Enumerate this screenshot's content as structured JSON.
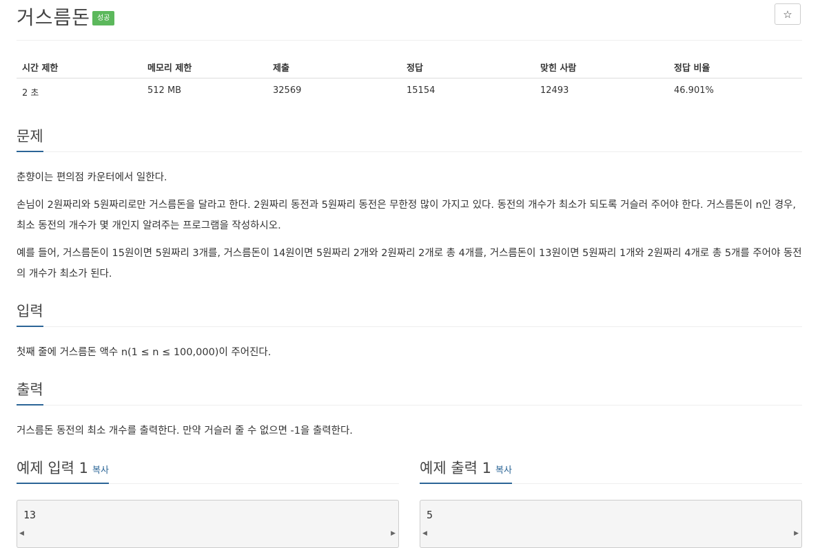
{
  "problem": {
    "title": "거스름돈",
    "badge": "성공",
    "star": "☆"
  },
  "info_table": {
    "headers": [
      "시간 제한",
      "메모리 제한",
      "제출",
      "정답",
      "맞힌 사람",
      "정답 비율"
    ],
    "values": [
      "2 초",
      "512 MB",
      "32569",
      "15154",
      "12493",
      "46.901%"
    ]
  },
  "sections": {
    "problem": {
      "title": "문제",
      "paragraphs": [
        "춘향이는 편의점 카운터에서 일한다.",
        "손님이 2원짜리와 5원짜리로만 거스름돈을 달라고 한다. 2원짜리 동전과 5원짜리 동전은 무한정 많이 가지고 있다. 동전의 개수가 최소가 되도록 거슬러 주어야 한다. 거스름돈이 n인 경우, 최소 동전의 개수가 몇 개인지 알려주는 프로그램을 작성하시오.",
        "예를 들어, 거스름돈이 15원이면 5원짜리 3개를, 거스름돈이 14원이면 5원짜리 2개와 2원짜리 2개로 총 4개를, 거스름돈이 13원이면 5원짜리 1개와 2원짜리 4개로 총 5개를 주어야 동전의 개수가 최소가 된다."
      ]
    },
    "input": {
      "title": "입력",
      "text": "첫째 줄에 거스름돈 액수 n(1 ≤ n ≤ 100,000)이 주어진다."
    },
    "output": {
      "title": "출력",
      "text": "거스름돈 동전의 최소 개수를 출력한다. 만약 거슬러 줄 수 없으면 -1을 출력한다."
    }
  },
  "samples": {
    "input": {
      "title": "예제 입력 1",
      "copy": "복사",
      "value": "13"
    },
    "output": {
      "title": "예제 출력 1",
      "copy": "복사",
      "value": "5"
    }
  }
}
